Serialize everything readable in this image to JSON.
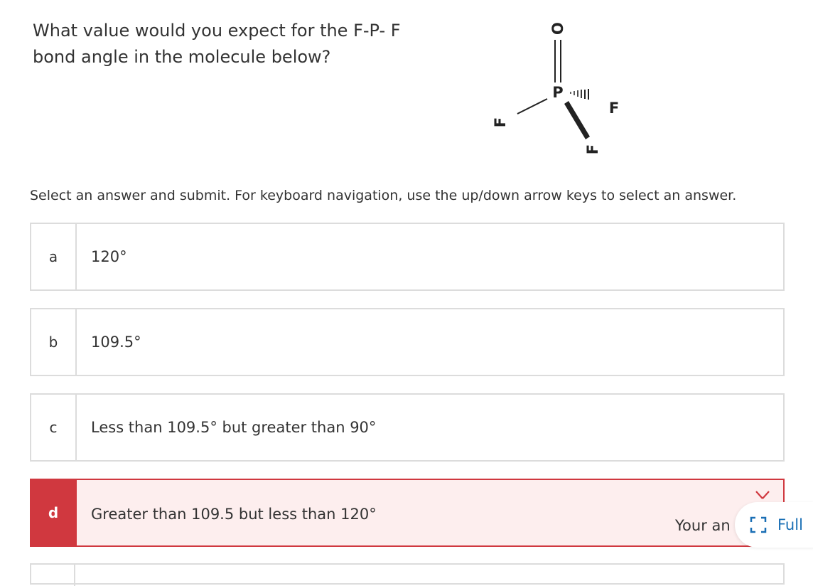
{
  "question": {
    "line1": "What value would you expect for the F-P- F",
    "line2": "bond angle in the molecule below?"
  },
  "molecule": {
    "atoms": {
      "oxygen": "O",
      "phosphorus": "P",
      "fluorine_left": "F",
      "fluorine_right": "F",
      "fluorine_bottom": "F"
    }
  },
  "instruction": "Select an answer and submit. For keyboard navigation, use the up/down arrow keys to select an answer.",
  "options": [
    {
      "letter": "a",
      "text": "120°"
    },
    {
      "letter": "b",
      "text": "109.5°"
    },
    {
      "letter": "c",
      "text": "Less than 109.5° but greater than 90°"
    },
    {
      "letter": "d",
      "text": "Greater than 109.5 but less than 120°",
      "state": "incorrect"
    }
  ],
  "feedback": {
    "text": "Your an"
  },
  "fullscreen": {
    "label": "Full",
    "icon": "fullscreen-icon"
  },
  "colors": {
    "incorrect": "#d0383f",
    "incorrect_bg": "#fdeeee",
    "link": "#1a6fb5",
    "border": "#dcdcdc"
  }
}
